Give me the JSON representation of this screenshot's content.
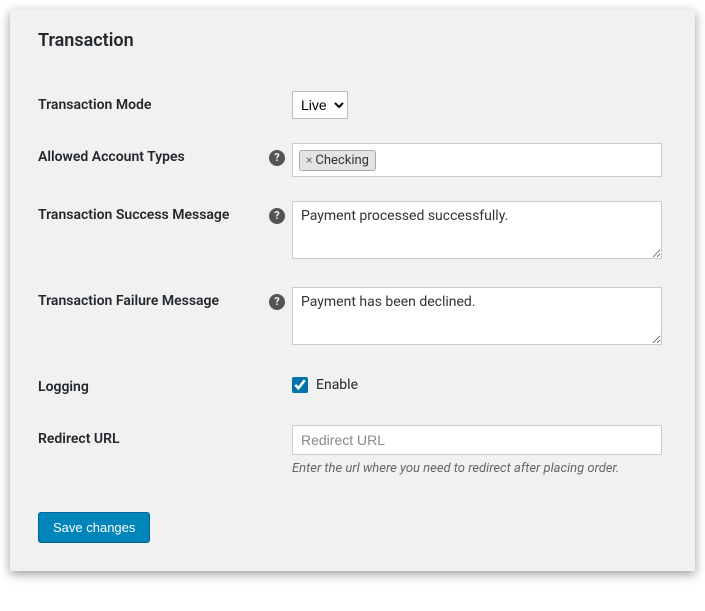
{
  "section": {
    "title": "Transaction"
  },
  "fields": {
    "mode": {
      "label": "Transaction Mode",
      "value": "Live",
      "options": [
        "Live"
      ]
    },
    "account_types": {
      "label": "Allowed Account Types",
      "tags": [
        "Checking"
      ]
    },
    "success_msg": {
      "label": "Transaction Success Message",
      "value": "Payment processed successfully."
    },
    "failure_msg": {
      "label": "Transaction Failure Message",
      "value": "Payment has been declined."
    },
    "logging": {
      "label": "Logging",
      "checkbox_label": "Enable",
      "checked": true
    },
    "redirect": {
      "label": "Redirect URL",
      "placeholder": "Redirect URL",
      "value": "",
      "description": "Enter the url where you need to redirect after placing order."
    }
  },
  "buttons": {
    "save": "Save changes"
  }
}
